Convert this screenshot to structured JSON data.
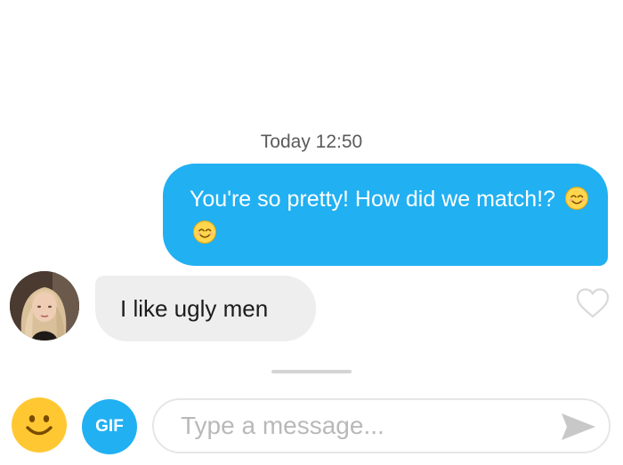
{
  "chat": {
    "timestamp": "Today 12:50",
    "messages": [
      {
        "direction": "outgoing",
        "text": "You're so pretty! How did we match!?",
        "emojis": [
          "smiling-face-icon",
          "smiling-face-icon"
        ]
      },
      {
        "direction": "incoming",
        "text": "I like ugly men",
        "avatar": "avatar"
      }
    ]
  },
  "composer": {
    "gif_label": "GIF",
    "placeholder": "Type a message...",
    "value": ""
  },
  "icons": {
    "emoji_button": "emoji-icon",
    "send_button": "send-icon",
    "like": "heart-icon"
  },
  "colors": {
    "outgoing_bubble": "#21b0f2",
    "incoming_bubble": "#eeeeee",
    "emoji_button": "#ffc833",
    "gif_button": "#21b0f2"
  }
}
